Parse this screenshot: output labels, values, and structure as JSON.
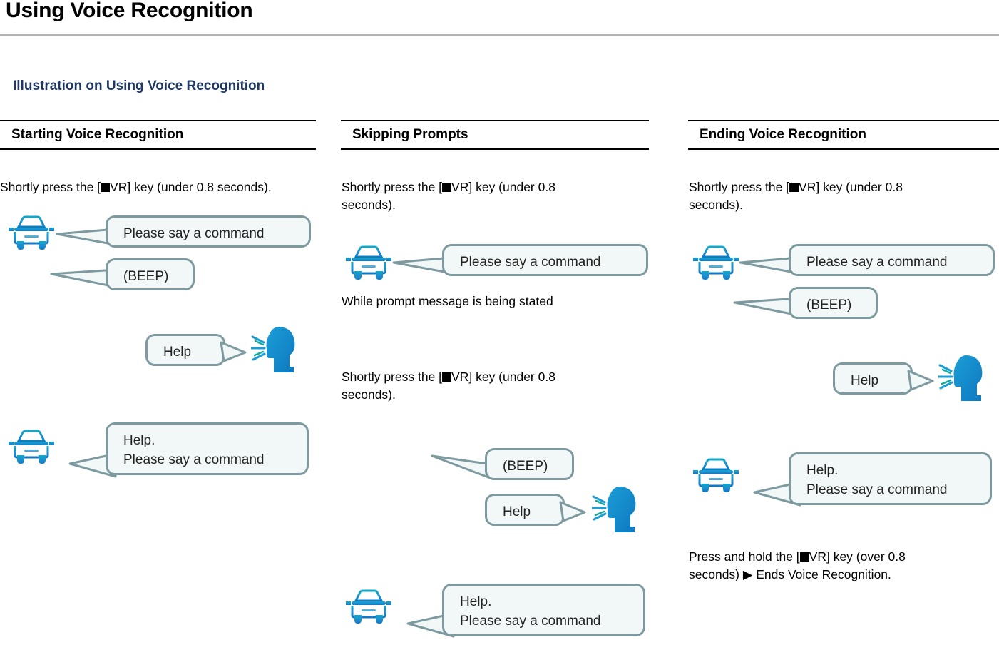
{
  "page": {
    "title": "Using Voice Recognition",
    "section_title": "Illustration on Using Voice Recognition",
    "rule_color": "#b2b2b2",
    "accent_color": "#1f3864",
    "bubble_border_color": "#7d9aa0",
    "bubble_fill_color": "#f2f7f7",
    "icon_color": "#1b8ed0"
  },
  "columns": [
    {
      "header": "Starting Voice Recognition",
      "steps": [
        {
          "text": "Shortly press the [■VR] key (under 0.8 seconds)."
        }
      ],
      "bubbles": [
        {
          "text": "Please say a command",
          "speaker": "car"
        },
        {
          "text": "(BEEP)",
          "speaker": "car"
        },
        {
          "text": "Help",
          "speaker": "person"
        },
        {
          "text": "Help.\nPlease say a command",
          "speaker": "car"
        }
      ],
      "icons": [
        {
          "name": "car-icon"
        },
        {
          "name": "speaking-person-icon"
        },
        {
          "name": "car-icon"
        }
      ]
    },
    {
      "header": "Skipping Prompts",
      "steps": [
        {
          "text": "Shortly press the [■VR] key (under 0.8 seconds)."
        },
        {
          "text": "While prompt message is being stated"
        },
        {
          "text": "Shortly press the [■VR] key (under 0.8 seconds)."
        }
      ],
      "bubbles": [
        {
          "text": "Please say a command",
          "speaker": "car"
        },
        {
          "text": "(BEEP)",
          "speaker": "car"
        },
        {
          "text": "Help",
          "speaker": "person"
        },
        {
          "text": "Help.\nPlease say a command",
          "speaker": "car"
        }
      ],
      "icons": [
        {
          "name": "car-icon"
        },
        {
          "name": "speaking-person-icon"
        },
        {
          "name": "car-icon"
        }
      ]
    },
    {
      "header": "Ending Voice Recognition",
      "steps": [
        {
          "text": "Shortly press the [■VR] key (under 0.8 seconds)."
        },
        {
          "text": "Press and hold the [■VR] key (over 0.8 seconds) ▶ Ends Voice Recognition."
        }
      ],
      "bubbles": [
        {
          "text": "Please say a command",
          "speaker": "car"
        },
        {
          "text": "(BEEP)",
          "speaker": "car"
        },
        {
          "text": "Help",
          "speaker": "person"
        },
        {
          "text": "Help.\nPlease say a command",
          "speaker": "car"
        }
      ],
      "icons": [
        {
          "name": "car-icon"
        },
        {
          "name": "speaking-person-icon"
        },
        {
          "name": "car-icon"
        }
      ]
    }
  ],
  "text_fragments": {
    "c1_step1_a": "Shortly press the [",
    "c1_step1_b": "VR] key (under 0.8 seconds).",
    "c2_step1_a": "Shortly press the [",
    "c2_step1_b": "VR] key (under 0.8",
    "c2_step1_c": "seconds).",
    "c2_mid": "While prompt message is being stated",
    "c2_step2_a": "Shortly press the [",
    "c2_step2_b": "VR] key (under 0.8",
    "c2_step2_c": "seconds).",
    "c3_step1_a": "Shortly press the [",
    "c3_step1_b": "VR] key (under 0.8",
    "c3_step1_c": "seconds).",
    "c3_step2_a": "Press and hold the [",
    "c3_step2_b": "VR] key (over 0.8",
    "c3_step2_c": "seconds) ▶  Ends Voice Recognition."
  },
  "bubble_texts": {
    "please_say": "Please say a command",
    "beep": "(BEEP)",
    "help": "Help",
    "help_please_line1": "Help.",
    "help_please_line2": "Please say a command"
  }
}
